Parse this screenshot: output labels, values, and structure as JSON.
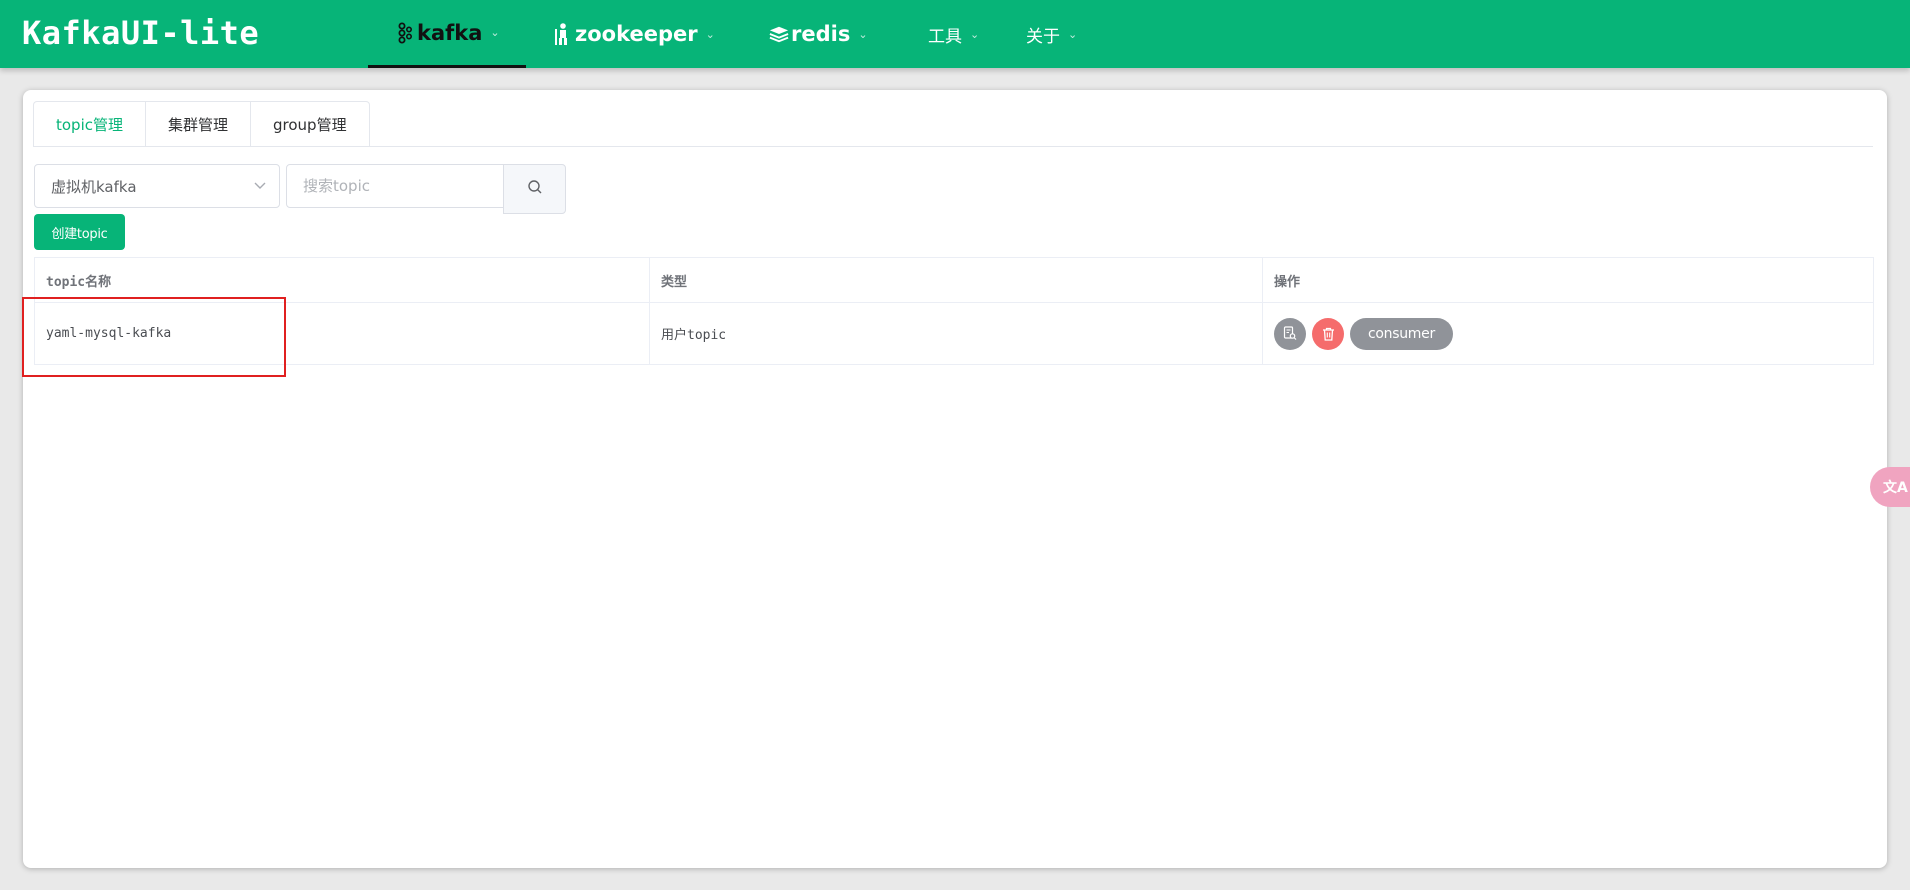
{
  "app": {
    "title": "KafkaUI-lite"
  },
  "nav": {
    "kafka": "kafka",
    "zookeeper": "zookeeper",
    "redis": "redis",
    "tools": "工具",
    "about": "关于"
  },
  "tabs": [
    {
      "label": "topic管理",
      "active": true
    },
    {
      "label": "集群管理",
      "active": false
    },
    {
      "label": "group管理",
      "active": false
    }
  ],
  "toolbar": {
    "cluster_select_value": "虚拟机kafka",
    "search_placeholder": "搜索topic",
    "create_label": "创建topic"
  },
  "table": {
    "headers": [
      "topic名称",
      "类型",
      "操作"
    ],
    "rows": [
      {
        "name": "yaml-mysql-kafka",
        "type": "用户topic",
        "consumer_label": "consumer"
      }
    ]
  },
  "floating": {
    "translate_label": "文A"
  },
  "colors": {
    "primary": "#07b478",
    "danger": "#f56c6c",
    "info": "#909399",
    "highlight": "#e02020"
  }
}
